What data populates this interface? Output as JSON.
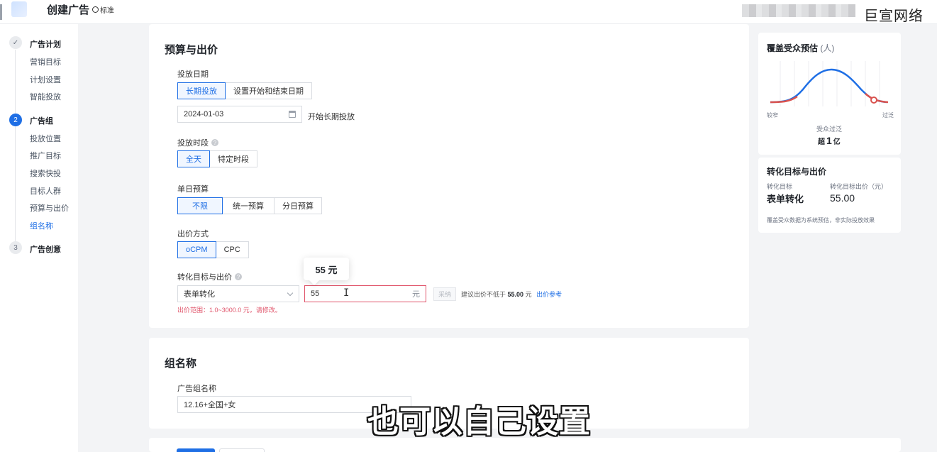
{
  "topbar": {
    "title": "创建广告",
    "badge": "标准",
    "brand": "巨宣网络"
  },
  "sidebar": {
    "groups": [
      {
        "step": "✓",
        "label": "广告计划",
        "items": [
          "营销目标",
          "计划设置",
          "智能投放"
        ]
      },
      {
        "step": "2",
        "label": "广告组",
        "items": [
          "投放位置",
          "推广目标",
          "搜索快投",
          "目标人群",
          "预算与出价",
          "组名称"
        ]
      },
      {
        "step": "3",
        "label": "广告创意",
        "items": []
      }
    ],
    "current_item": "组名称"
  },
  "budget": {
    "section_title": "预算与出价",
    "date": {
      "label": "投放日期",
      "options": [
        "长期投放",
        "设置开始和结束日期"
      ],
      "selected": "长期投放",
      "start_value": "2024-01-03",
      "start_hint": "开始长期投放"
    },
    "period": {
      "label": "投放时段",
      "options": [
        "全天",
        "特定时段"
      ],
      "selected": "全天"
    },
    "daily": {
      "label": "单日预算",
      "options": [
        "不限",
        "统一预算",
        "分日预算"
      ],
      "selected": "不限"
    },
    "bid_method": {
      "label": "出价方式",
      "options": [
        "oCPM",
        "CPC"
      ],
      "selected": "oCPM"
    },
    "conversion": {
      "label": "转化目标与出价",
      "target_value": "表单转化",
      "bid_value": "55",
      "bid_unit": "元",
      "tooltip": "55 元",
      "adopt_label": "采纳",
      "hint_prefix": "建议出价不低于",
      "hint_value": "55.00",
      "hint_unit": "元",
      "hint_link": "出价参考",
      "error": "出价范围：1.0~3000.0 元，请修改。"
    }
  },
  "group_name": {
    "section_title": "组名称",
    "label": "广告组名称",
    "value": "12.16+全国+女"
  },
  "audience": {
    "title": "覆盖受众预估",
    "title_unit": "(人)",
    "left_label": "较窄",
    "right_label": "过泛",
    "status": "受众过泛",
    "count_prefix": "超",
    "count_value": "1",
    "count_unit": "亿"
  },
  "conversion_summary": {
    "title": "转化目标与出价",
    "target_label": "转化目标",
    "target_value": "表单转化",
    "bid_label": "转化目标出价（元）",
    "bid_value": "55.00",
    "note": "覆盖受众数据为系统预估，非实际投放效果"
  },
  "subtitle": "也可以自己设置",
  "colors": {
    "accent": "#1f6fe5",
    "error": "#e0556b",
    "curve_red": "#d9534f"
  }
}
